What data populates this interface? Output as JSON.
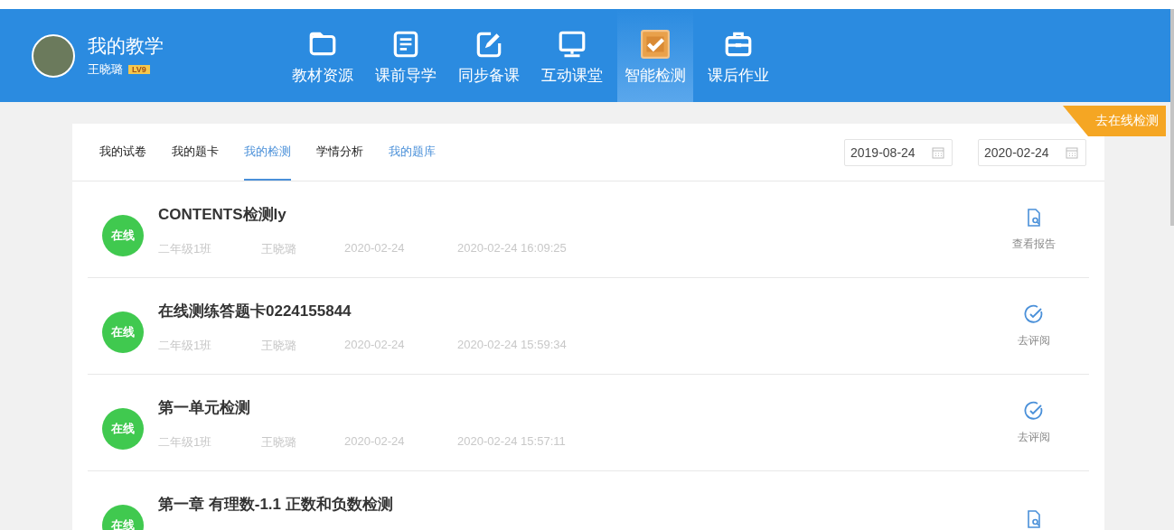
{
  "header": {
    "title": "我的教学",
    "user": "王晓璐",
    "level_badge": "LV9",
    "nav": [
      {
        "label": "教材资源",
        "kind": "folder",
        "selected": false
      },
      {
        "label": "课前导学",
        "kind": "doc",
        "selected": false
      },
      {
        "label": "同步备课",
        "kind": "edit",
        "selected": false
      },
      {
        "label": "互动课堂",
        "kind": "monitor",
        "selected": false
      },
      {
        "label": "智能检测",
        "kind": "check",
        "selected": true
      },
      {
        "label": "课后作业",
        "kind": "case",
        "selected": false
      }
    ]
  },
  "ribbon": "去在线检测",
  "tabs": [
    {
      "label": "我的试卷",
      "kind": "tab",
      "selected": false
    },
    {
      "label": "我的题卡",
      "kind": "tab",
      "selected": false
    },
    {
      "label": "我的检测",
      "kind": "tab",
      "selected": true
    },
    {
      "label": "学情分析",
      "kind": "tab",
      "selected": false
    },
    {
      "label": "我的题库",
      "kind": "link",
      "selected": false
    }
  ],
  "date_from": "2019-08-24",
  "date_to": "2020-02-24",
  "rows": [
    {
      "badge": "在线",
      "title": "CONTENTS检测ly",
      "meta": [
        "二年级1班",
        "王晓璐",
        "2020-02-24",
        "2020-02-24 16:09:25"
      ],
      "action": {
        "kind": "report",
        "label": "查看报告"
      }
    },
    {
      "badge": "在线",
      "title": "在线测练答题卡0224155844",
      "meta": [
        "二年级1班",
        "王晓璐",
        "2020-02-24",
        "2020-02-24 15:59:34"
      ],
      "action": {
        "kind": "review",
        "label": "去评阅"
      }
    },
    {
      "badge": "在线",
      "title": "第一单元检测",
      "meta": [
        "二年级1班",
        "王晓璐",
        "2020-02-24",
        "2020-02-24 15:57:11"
      ],
      "action": {
        "kind": "review",
        "label": "去评阅"
      }
    },
    {
      "badge": "在线",
      "title": "第一章 有理数-1.1 正数和负数检测",
      "meta": [],
      "action": {
        "kind": "report"
      }
    }
  ]
}
